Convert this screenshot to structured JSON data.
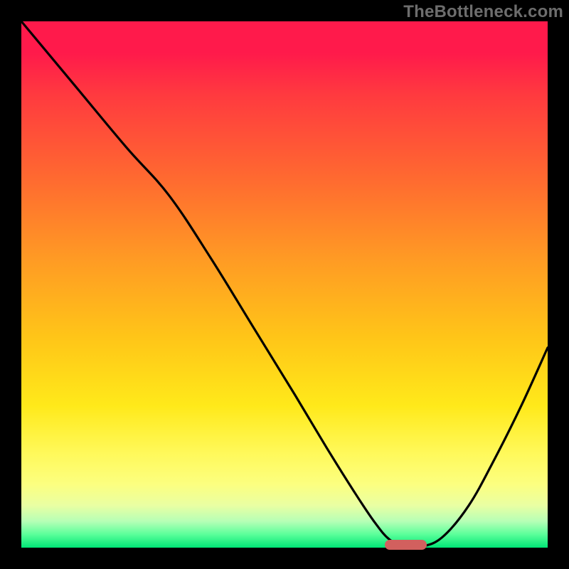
{
  "watermark": "TheBottleneck.com",
  "colors": {
    "frame": "#000000",
    "curve": "#000000",
    "marker": "#d2605e",
    "watermark": "#6d6d6d",
    "gradient_top": "#ff1a4b",
    "gradient_bottom": "#00e676"
  },
  "chart_data": {
    "type": "line",
    "title": "",
    "xlabel": "",
    "ylabel": "",
    "xlim": [
      0,
      100
    ],
    "ylim": [
      0,
      100
    ],
    "grid": false,
    "legend": false,
    "x": [
      0,
      10,
      20,
      28,
      36,
      44,
      52,
      58,
      63,
      67,
      70,
      73,
      76,
      80,
      85,
      90,
      95,
      100
    ],
    "y": [
      100,
      88,
      76,
      67,
      55,
      42,
      29,
      19,
      11,
      5,
      1.5,
      0.2,
      0.2,
      2,
      8,
      17,
      27,
      38
    ],
    "marker": {
      "x_start": 69,
      "x_end": 77,
      "y": 0.5
    },
    "annotations": []
  }
}
